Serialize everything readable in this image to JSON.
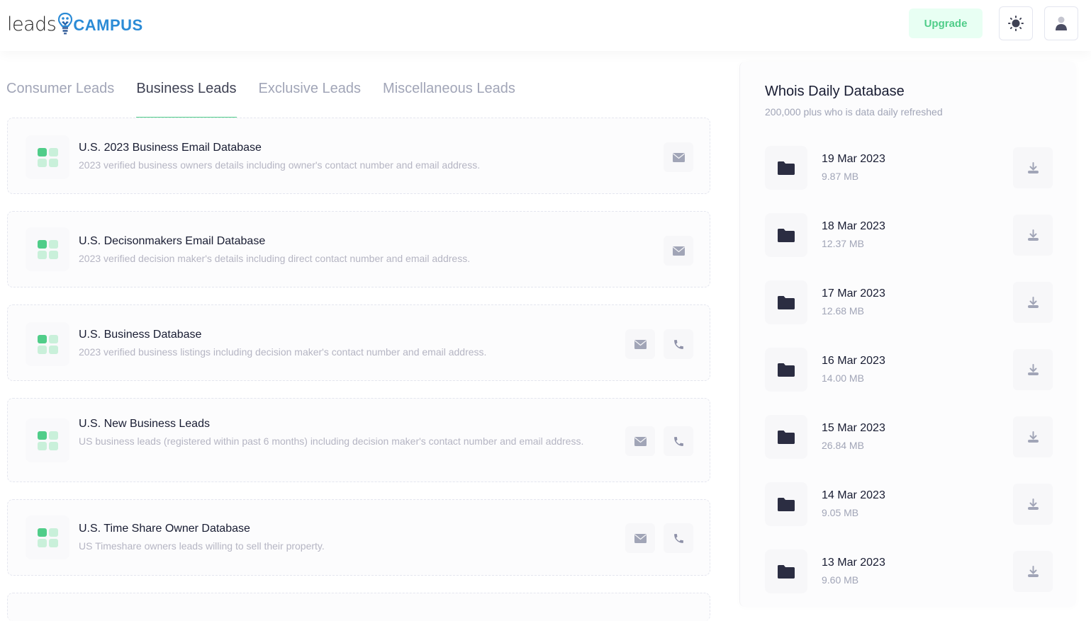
{
  "brand": {
    "part1": "leads",
    "part2": "CAMPUS"
  },
  "header": {
    "upgrade_label": "Upgrade",
    "theme_icon": "sun-icon",
    "user_icon": "user-icon"
  },
  "colors": {
    "accent": "#50cd89",
    "accent_light": "#e8fff3",
    "brand_blue": "#2b8bd6",
    "muted": "#a1a5b7"
  },
  "tabs": [
    {
      "label": "Consumer Leads",
      "active": false
    },
    {
      "label": "Business Leads",
      "active": true
    },
    {
      "label": "Exclusive Leads",
      "active": false
    },
    {
      "label": "Miscellaneous Leads",
      "active": false
    }
  ],
  "leads": [
    {
      "title": "U.S. 2023 Business Email Database",
      "description": "2023 verified business owners details including owner's contact number and email address.",
      "actions": [
        "email"
      ]
    },
    {
      "title": "U.S. Decisonmakers Email Database",
      "description": "2023 verified decision maker's details including direct contact number and email address.",
      "actions": [
        "email"
      ]
    },
    {
      "title": "U.S. Business Database",
      "description": "2023 verified business listings including decision maker's contact number and email address.",
      "actions": [
        "email",
        "phone"
      ]
    },
    {
      "title": "U.S. New Business Leads",
      "description": "US business leads (registered within past 6 months) including decision maker's contact number and email address.",
      "actions": [
        "email",
        "phone"
      ]
    },
    {
      "title": "U.S. Time Share Owner Database",
      "description": "US Timeshare owners leads willing to sell their property.",
      "actions": [
        "email",
        "phone"
      ]
    }
  ],
  "whois": {
    "title": "Whois Daily Database",
    "subtitle": "200,000 plus who is data daily refreshed",
    "files": [
      {
        "date": "19 Mar 2023",
        "size": "9.87 MB"
      },
      {
        "date": "18 Mar 2023",
        "size": "12.37 MB"
      },
      {
        "date": "17 Mar 2023",
        "size": "12.68 MB"
      },
      {
        "date": "16 Mar 2023",
        "size": "14.00 MB"
      },
      {
        "date": "15 Mar 2023",
        "size": "26.84 MB"
      },
      {
        "date": "14 Mar 2023",
        "size": "9.05 MB"
      },
      {
        "date": "13 Mar 2023",
        "size": "9.60 MB"
      }
    ]
  }
}
